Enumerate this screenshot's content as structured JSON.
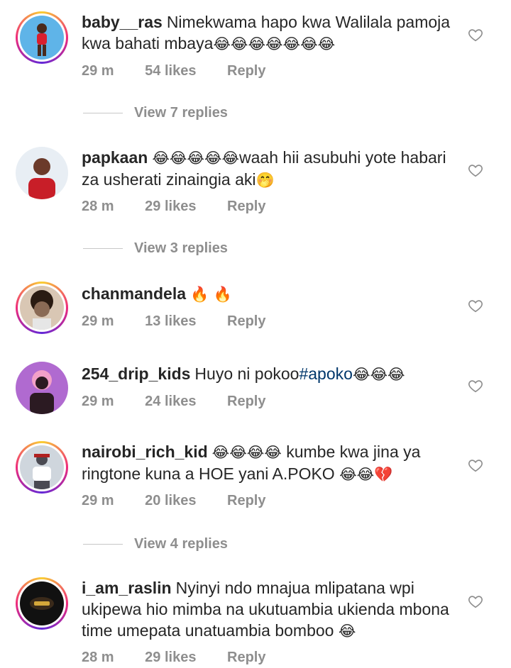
{
  "comments": [
    {
      "username": "baby__ras",
      "text_parts": [
        "Nimekwama hapo kwa Walilala pamoja kwa bahati mbaya",
        "😂😂😂😂😂😂😂"
      ],
      "time": "29 m",
      "likes": "54 likes",
      "reply": "Reply",
      "view_replies": "View 7 replies",
      "avatar_colors": [
        "#5fb4e8",
        "#d9202e",
        "#7fc4ea"
      ]
    },
    {
      "username": "papkaan",
      "text_parts": [
        "😂😂😂😂😂",
        "waah hii asubuhi yote habari za usherati zinaingia aki",
        "🤭"
      ],
      "time": "28 m",
      "likes": "29 likes",
      "reply": "Reply",
      "view_replies": "View 3 replies",
      "avatar_colors": [
        "#e8eef4",
        "#6b3a2a",
        "#c81e28"
      ]
    },
    {
      "username": "chanmandela",
      "text_parts": [
        "🔥 🔥"
      ],
      "time": "29 m",
      "likes": "13 likes",
      "reply": "Reply",
      "avatar_colors": [
        "#d9c7b4",
        "#2a1b12",
        "#8a6a55"
      ]
    },
    {
      "username": "254_drip_kids",
      "text_parts": [
        "Huyo ni pokoo",
        "#apoko",
        "😂😂😂"
      ],
      "time": "29 m",
      "likes": "24 likes",
      "reply": "Reply",
      "avatar_colors": [
        "#b06ad0",
        "#f2a0c8",
        "#2b1a22"
      ]
    },
    {
      "username": "nairobi_rich_kid",
      "text_parts": [
        "😂😂😂😂",
        " kumbe kwa jina ya ringtone kuna a HOE yani A.POKO ",
        "😂😂💔"
      ],
      "time": "29 m",
      "likes": "20 likes",
      "reply": "Reply",
      "view_replies": "View 4 replies",
      "avatar_colors": [
        "#cfd6dd",
        "#4a4a52",
        "#b02020"
      ]
    },
    {
      "username": "i_am_raslin",
      "text_parts": [
        "Nyinyi ndo mnajua mlipatana wpi ukipewa hio mimba na ukutuambia ukienda mbona time umepata unatuambia bomboo ",
        "😂"
      ],
      "time": "28 m",
      "likes": "29 likes",
      "reply": "Reply",
      "avatar_colors": [
        "#111111",
        "#d4a73a",
        "#3a2a1a"
      ]
    }
  ]
}
